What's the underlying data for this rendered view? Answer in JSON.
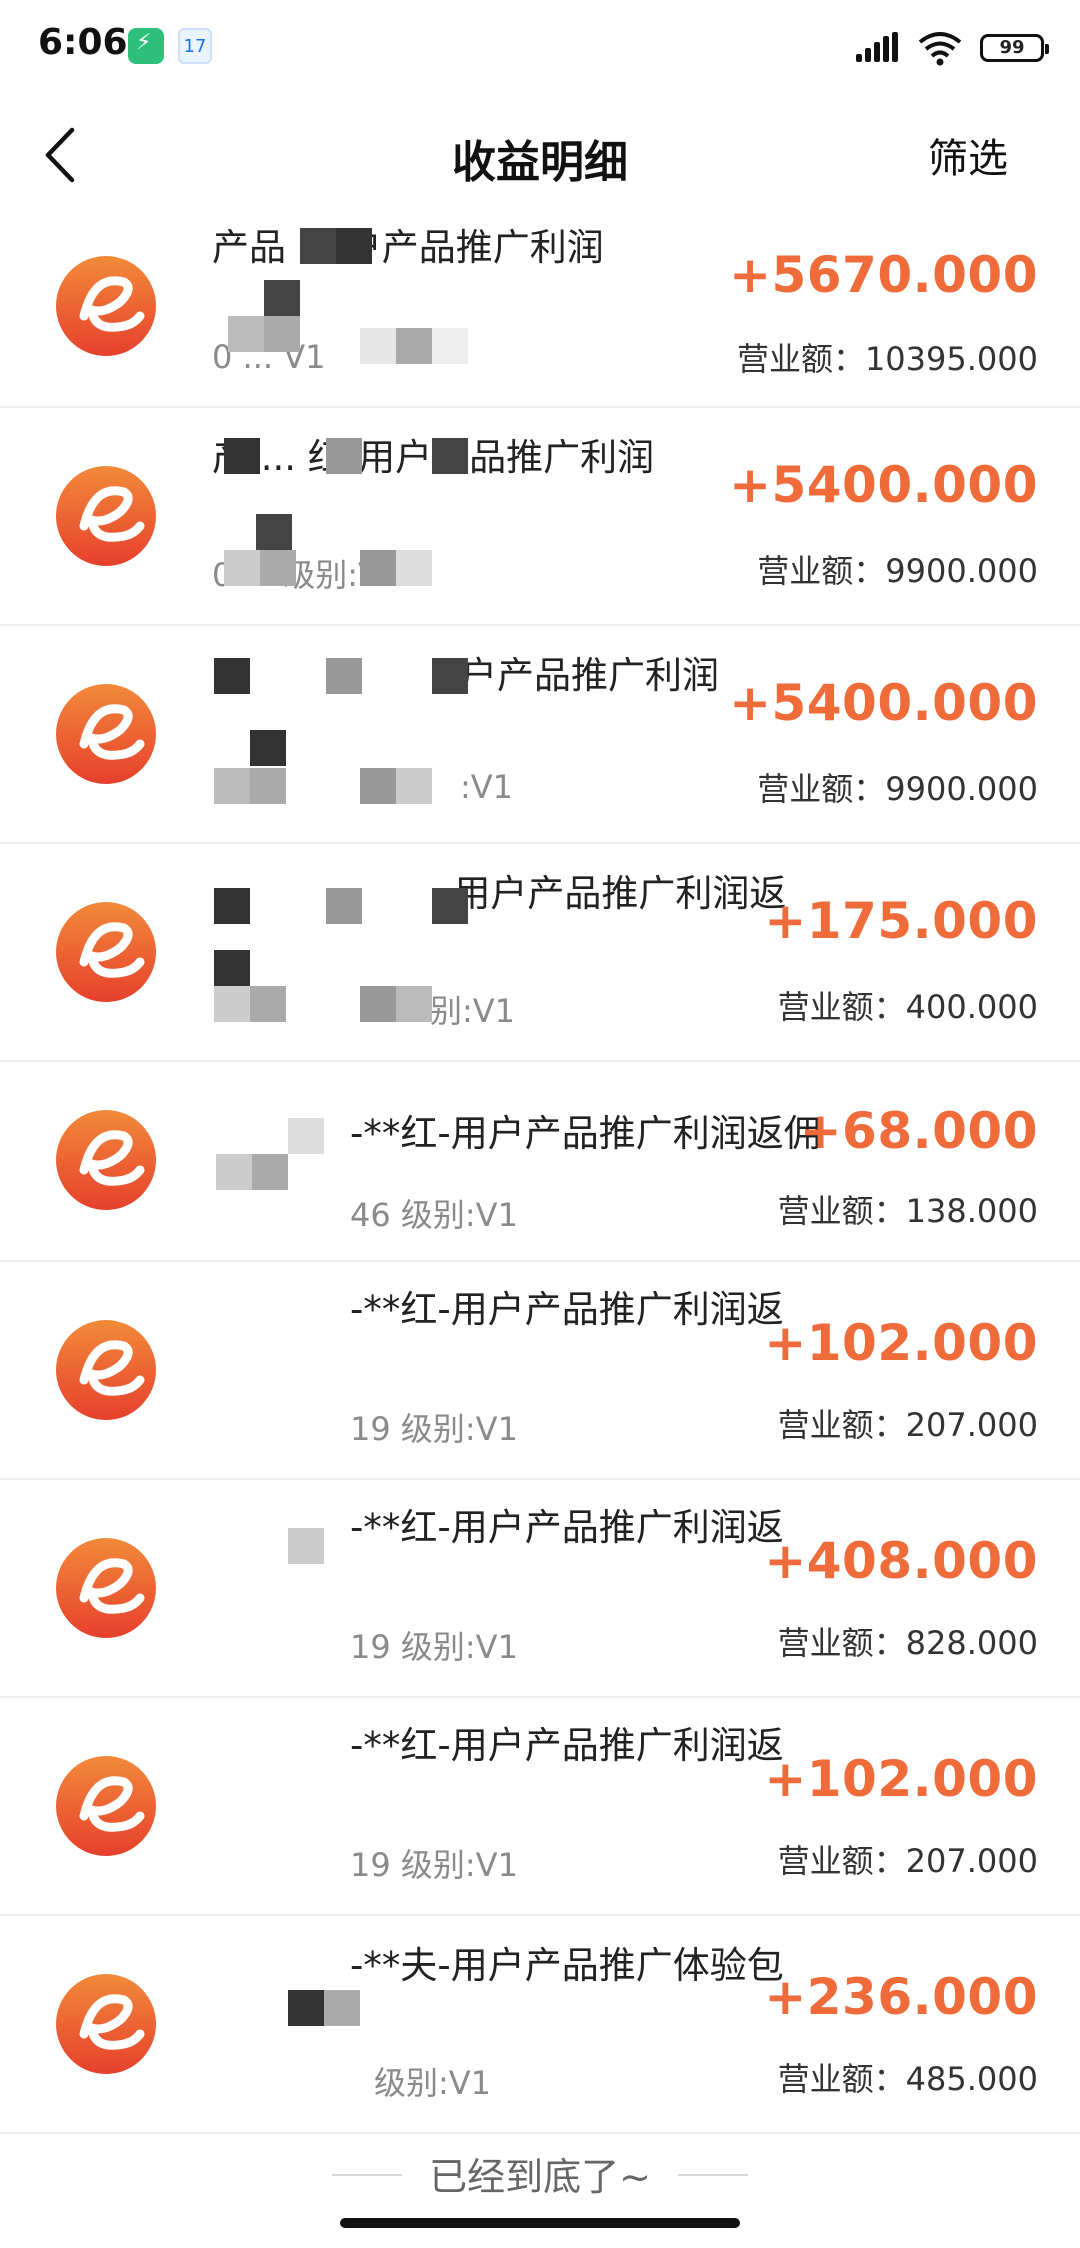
{
  "status_bar": {
    "time": "6:06",
    "calendar_day": "17",
    "battery": "99"
  },
  "header": {
    "title": "收益明细",
    "filter_label": "筛选"
  },
  "items": [
    {
      "title": "产品 ... 户产品推广利润",
      "title_line2": "",
      "sub": "0 ... V1",
      "amount": "+5670.000",
      "revenue": "营业额：10395.000"
    },
    {
      "title": "产 ... 红-用户产品推广利润",
      "title_line2": "",
      "sub": "0 ... 级别:V1",
      "amount": "+5400.000",
      "revenue": "营业额：9900.000"
    },
    {
      "title": "户产品推广利润",
      "title_line2": "",
      "sub": ":V1",
      "amount": "+5400.000",
      "revenue": "营业额：9900.000"
    },
    {
      "title": "-用户产品推广利润返",
      "title_line2": "",
      "sub": "别:V1",
      "amount": "+175.000",
      "revenue": "营业额：400.000"
    },
    {
      "title": "-**红-用户产品推广利润返佣",
      "title_line2": "",
      "sub": "46 级别:V1",
      "amount": "+68.000",
      "revenue": "营业额：138.000"
    },
    {
      "title": "-**红-用户产品推广利润返",
      "title_line2": "",
      "sub": "19 级别:V1",
      "amount": "+102.000",
      "revenue": "营业额：207.000"
    },
    {
      "title": "-**红-用户产品推广利润返",
      "title_line2": "",
      "sub": "19 级别:V1",
      "amount": "+408.000",
      "revenue": "营业额：828.000"
    },
    {
      "title": "-**红-用户产品推广利润返",
      "title_line2": "",
      "sub": "19 级别:V1",
      "amount": "+102.000",
      "revenue": "营业额：207.000"
    },
    {
      "title": "-**夫-用户产品推广体验包",
      "title_line2": "",
      "sub": "级别:V1",
      "amount": "+236.000",
      "revenue": "营业额：485.000"
    }
  ],
  "footer": {
    "end_text": "已经到底了~"
  },
  "colors": {
    "accent": "#ef6b3a",
    "logo_top": "#f28a3a",
    "logo_bottom": "#e6402c"
  }
}
